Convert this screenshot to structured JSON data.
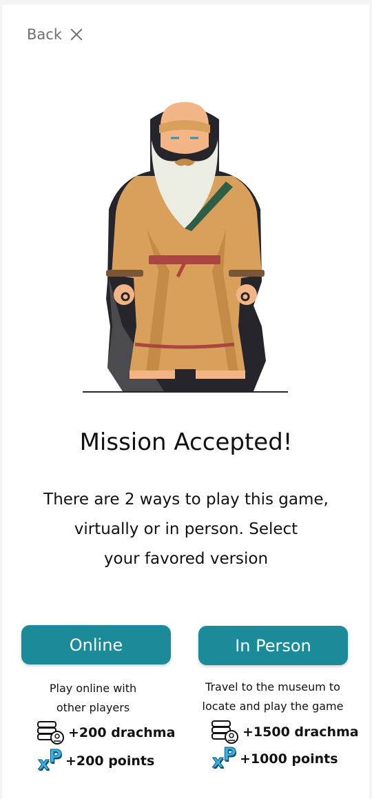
{
  "header": {
    "back_label": "Back"
  },
  "main": {
    "title": "Mission Accepted!",
    "description_lines": [
      "There are 2 ways to play this game,",
      "virtually or in person. Select",
      "your favored version"
    ]
  },
  "options": {
    "online": {
      "button_label": "Online",
      "sub_lines": [
        "Play online with",
        "other players"
      ],
      "drachma": "+200 drachma",
      "points": "+200 points"
    },
    "in_person": {
      "button_label": "In Person",
      "sub_lines": [
        "Travel to the museum to",
        "locate and play the game"
      ],
      "drachma": "+1500 drachma",
      "points": "+1000 points"
    }
  },
  "icons": {
    "close": "close-icon",
    "coins": "coin-stack-icon",
    "xp": "xp-icon"
  },
  "colors": {
    "accent": "#1b8b9a",
    "robe": "#d9a05b",
    "cloak": "#25252b",
    "xp": "#35b6e8"
  }
}
